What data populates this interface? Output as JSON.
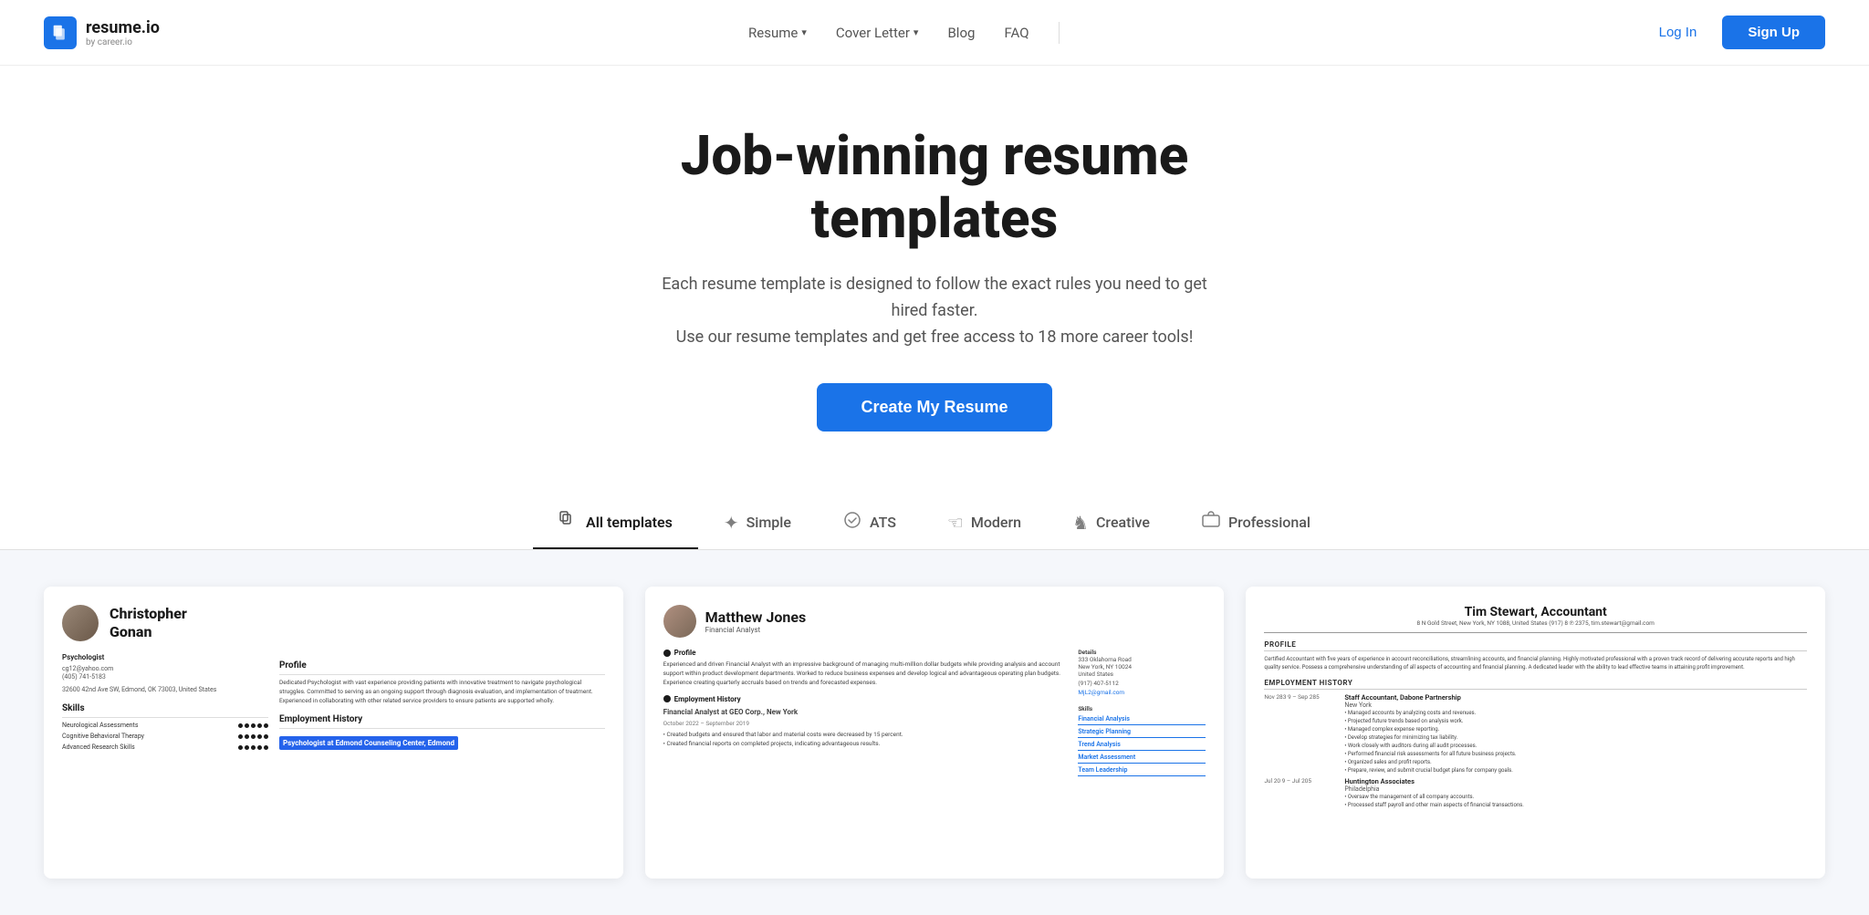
{
  "nav": {
    "logo_title": "resume.io",
    "logo_sub": "by career.io",
    "links": [
      {
        "label": "Resume",
        "has_dropdown": true
      },
      {
        "label": "Cover Letter",
        "has_dropdown": true
      },
      {
        "label": "Blog",
        "has_dropdown": false
      },
      {
        "label": "FAQ",
        "has_dropdown": false
      }
    ],
    "login_label": "Log In",
    "signup_label": "Sign Up"
  },
  "hero": {
    "title": "Job-winning resume templates",
    "subtitle": "Each resume template is designed to follow the exact rules you need to get hired faster.\nUse our resume templates and get free access to 18 more career tools!",
    "cta_label": "Create My Resume"
  },
  "filters": {
    "tabs": [
      {
        "id": "all",
        "label": "All templates",
        "icon": "⊞",
        "active": true
      },
      {
        "id": "simple",
        "label": "Simple",
        "icon": "✦",
        "active": false
      },
      {
        "id": "ats",
        "label": "ATS",
        "icon": "◎",
        "active": false
      },
      {
        "id": "modern",
        "label": "Modern",
        "icon": "☜",
        "active": false
      },
      {
        "id": "creative",
        "label": "Creative",
        "icon": "♞",
        "active": false
      },
      {
        "id": "professional",
        "label": "Professional",
        "icon": "⊡",
        "active": false
      }
    ]
  },
  "templates": [
    {
      "id": "christopher",
      "person_name": "Christopher\nGonan",
      "role": "Psychologist",
      "email": "cg12@yahoo.com",
      "phone": "(405) 741-5183",
      "address": "32600 42nd Ave SW, Edmond, OK 73003, United States",
      "profile_text": "Dedicated Psychologist with vast experience providing patients with innovative treatment to navigate psychological struggles. Committed to serving as an ongoing support through diagnosis evaluation, and implementation of treatment. Experienced in collaborating with other related service providers to ensure patients are supported wholly.",
      "section_employment": "Employment History",
      "section_skills": "Skills",
      "current_job": "Psychologist at Edmond Counseling Center, Edmond",
      "skills": [
        {
          "name": "Neurological Assessments",
          "score": "5/5"
        },
        {
          "name": "Cognitive Behavioral Therapy",
          "score": "5/5"
        },
        {
          "name": "Advanced Research Skills",
          "score": "5/5"
        }
      ]
    },
    {
      "id": "matthew",
      "person_name": "Matthew Jones",
      "role": "Financial Analyst",
      "profile_title": "Profile",
      "profile_text": "Experienced and driven Financial Analyst with an impressive background of managing multi-million dollar budgets while providing analysis and account support within product development departments. Worked to reduce business expenses and develop logical and advantageous operating plan budgets. Experience creating quarterly accruals based on trends and forecasted expenses.",
      "section_employment": "Employment History",
      "job_title": "Financial Analyst at GEO Corp., New York",
      "job_dates": "October 2022 – September 2019",
      "bullets": [
        "Created budgets and ensured that labor and material costs were decreased by 15 percent.",
        "Created financial reports on completed projects, indicating advantageous results."
      ],
      "details_label": "Details",
      "address": "333 Oklahoma Road\nNew York, NY 10024\nUnited States",
      "phone": "(917) 407-5112",
      "email": "MjL2@gmail.com",
      "skills_label": "Skills",
      "skills": [
        "Financial Analysis",
        "Strategic Planning",
        "Trend Analysis",
        "Market Assessment",
        "Team Leadership"
      ]
    },
    {
      "id": "tim",
      "person_name": "Tim Stewart, Accountant",
      "contact": "8 N Gold Street, New York, NY 1088, United States (917) 8 ℗ 2375, tim.stewart@gmail.com",
      "section_profile": "PROFILE",
      "profile_text": "Certified Accountant with five years of experience in account reconciliations, streamlining accounts, and financial planning. Highly motivated professional with a proven track record of delivering accurate reports and high quality service. Possess a comprehensive understanding of all aspects of accounting and financial planning. A dedicated leader with the ability to lead effective teams in attaining profit improvement.",
      "section_employment": "EMPLOYMENT HISTORY",
      "jobs": [
        {
          "dates": "Nov 283 9 – Sep 285",
          "title": "Staff Accountant, Dabone Partnership",
          "location": "New York",
          "bullets": [
            "Managed accounts by analyzing costs and revenues.",
            "Projected future trends based on analysis work.",
            "Managed complex expense reporting.",
            "Develop strategies for minimizing tax liability.",
            "Work closely with auditors during all audit processes.",
            "Performed financial risk assessments for all future business projects.",
            "Organized sales and profit reports.",
            "Prepare, review, and submit crucial budget plans for company goals."
          ]
        },
        {
          "dates": "Jul 20 9 – Jul 205",
          "title": "Huntington Associates",
          "location": "Philadelphia",
          "bullets": [
            "Oversaw the management of all company accounts.",
            "Processed staff payroll and other main aspects of financial transactions."
          ]
        }
      ]
    }
  ]
}
